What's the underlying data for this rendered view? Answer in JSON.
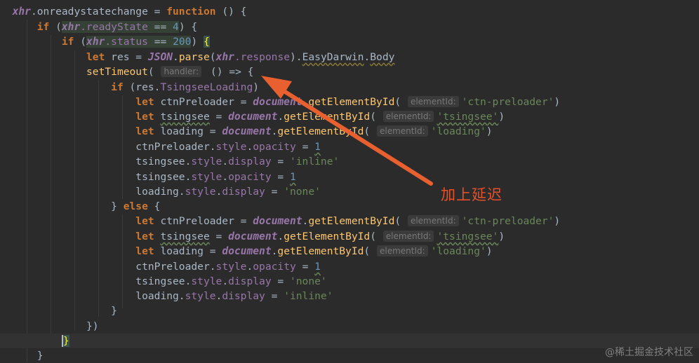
{
  "annotation": {
    "text": "加上延迟",
    "color": "#e8502a"
  },
  "watermark": {
    "text": "@稀土掘金技术社区"
  },
  "colors": {
    "background": "#2b2b2b",
    "keyword": "#cc7832",
    "string": "#6a8759",
    "number": "#6897bb",
    "function": "#ffc66d",
    "property": "#9876aa"
  },
  "code": {
    "l0": {
      "a": "xhr",
      "b": ".onreadystatechange = ",
      "c": "function",
      "d": " () {"
    },
    "l1": {
      "a": "if",
      "b": " (",
      "c": "xhr",
      "d": ".readyState",
      "e": " == ",
      "f": "4",
      "g": ") {"
    },
    "l2": {
      "a": "if",
      "b": " (",
      "c": "xhr",
      "d": ".status",
      "e": " == ",
      "f": "200",
      "g": ") ",
      "h": "{"
    },
    "l3": {
      "a": "let",
      "b": " res = ",
      "c": "JSON",
      "d": ".",
      "e": "parse",
      "f": "(",
      "g": "xhr",
      "h": ".response",
      "i": ").",
      "j": "EasyDarwin",
      "k": ".",
      "l": "Body"
    },
    "l4": {
      "a": "setTimeout",
      "b": "( ",
      "hint": "handler:",
      "c": " () => {"
    },
    "l5": {
      "a": "if",
      "b": " (res.",
      "c": "TsingseeLoading",
      "d": ")"
    },
    "l6": {
      "a": "let",
      "b": " ctnPreloader = ",
      "c": "document",
      "d": ".",
      "e": "getElementById",
      "f": "( ",
      "hint": "elementId:",
      "g": "'ctn-preloader'",
      "h": ")"
    },
    "l7": {
      "a": "let",
      "b": " ",
      "c": "tsingsee",
      "d": " = ",
      "e": "document",
      "f": ".",
      "g": "getElementById",
      "h": "( ",
      "hint": "elementId:",
      "i": "'tsingsee'",
      "j": ")"
    },
    "l8": {
      "a": "let",
      "b": " loading = ",
      "c": "document",
      "d": ".",
      "e": "getElementById",
      "f": "( ",
      "hint": "elementId:",
      "g": "'loading'",
      "h": ")"
    },
    "l9": {
      "a": "ctnPreloader.",
      "b": "style",
      "c": ".",
      "d": "opacity",
      "e": " = ",
      "f": "1"
    },
    "l10": {
      "a": "tsingsee.",
      "b": "style",
      "c": ".",
      "d": "display",
      "e": " = ",
      "f": "'inline'"
    },
    "l11": {
      "a": "tsingsee.",
      "b": "style",
      "c": ".",
      "d": "opacity",
      "e": " = ",
      "f": "1"
    },
    "l12": {
      "a": "loading.",
      "b": "style",
      "c": ".",
      "d": "display",
      "e": " = ",
      "f": "'none'"
    },
    "l13": {
      "a": "} ",
      "b": "else",
      "c": " {"
    },
    "l14": {
      "a": "let",
      "b": " ctnPreloader = ",
      "c": "document",
      "d": ".",
      "e": "getElementById",
      "f": "( ",
      "hint": "elementId:",
      "g": "'ctn-preloader'",
      "h": ")"
    },
    "l15": {
      "a": "let",
      "b": " ",
      "c": "tsingsee",
      "d": " = ",
      "e": "document",
      "f": ".",
      "g": "getElementById",
      "h": "( ",
      "hint": "elementId:",
      "i": "'tsingsee'",
      "j": ")"
    },
    "l16": {
      "a": "let",
      "b": " loading = ",
      "c": "document",
      "d": ".",
      "e": "getElementById",
      "f": "( ",
      "hint": "elementId:",
      "g": "'loading'",
      "h": ")"
    },
    "l17": {
      "a": "ctnPreloader.",
      "b": "style",
      "c": ".",
      "d": "opacity",
      "e": " = ",
      "f": "1"
    },
    "l18": {
      "a": "tsingsee.",
      "b": "style",
      "c": ".",
      "d": "display",
      "e": " = ",
      "f": "'none'"
    },
    "l19": {
      "a": "loading.",
      "b": "style",
      "c": ".",
      "d": "display",
      "e": " = ",
      "f": "'inline'"
    },
    "l20": {
      "a": "}"
    },
    "l21": {
      "a": "})"
    },
    "l22": {
      "a": "}"
    },
    "l23": {
      "a": "}"
    }
  }
}
